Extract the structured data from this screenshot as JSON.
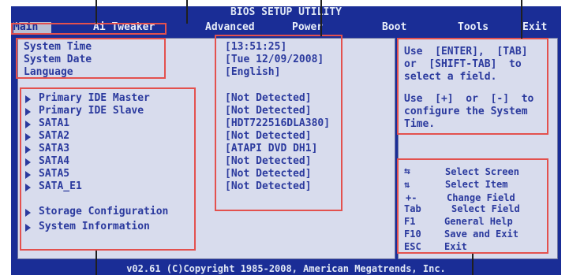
{
  "header": {
    "title": "BIOS SETUP UTILITY",
    "menu": [
      {
        "label": "Main",
        "active": true
      },
      {
        "label": "Ai Tweaker",
        "active": false
      },
      {
        "label": "Advanced",
        "active": false
      },
      {
        "label": "Power",
        "active": false
      },
      {
        "label": "Boot",
        "active": false
      },
      {
        "label": "Tools",
        "active": false
      },
      {
        "label": "Exit",
        "active": false
      }
    ]
  },
  "system": {
    "time_label": "System Time",
    "date_label": "System Date",
    "language_label": "Language",
    "time_value": "[13:51:25]",
    "date_value": "[Tue 12/09/2008]",
    "language_value": "[English]"
  },
  "devices": [
    {
      "label": "Primary IDE Master",
      "value": "[Not Detected]"
    },
    {
      "label": "Primary IDE Slave",
      "value": "[Not Detected]"
    },
    {
      "label": "SATA1",
      "value": "[HDT722516DLA380]"
    },
    {
      "label": "SATA2",
      "value": "[Not Detected]"
    },
    {
      "label": "SATA3",
      "value": "[ATAPI DVD DH1]"
    },
    {
      "label": "SATA4",
      "value": "[Not Detected]"
    },
    {
      "label": "SATA5",
      "value": "[Not Detected]"
    },
    {
      "label": "SATA_E1",
      "value": "[Not Detected]"
    }
  ],
  "submenus": {
    "storage": "Storage Configuration",
    "sysinfo": "System Information"
  },
  "help": {
    "line1": "Use  [ENTER],  [TAB]",
    "line2": "or  [SHIFT-TAB]  to",
    "line3": "select a field.",
    "line4": "Use  [+]  or  [-]  to",
    "line5": "configure the System",
    "line6": "Time."
  },
  "keys": {
    "select_screen": "Select Screen",
    "select_item": "Select Item",
    "plus_minus": "+-",
    "change_field": "Change Field",
    "tab": "Tab",
    "select_field": "Select Field",
    "f1": "F1",
    "general_help": "General Help",
    "f10": "F10",
    "save_exit": "Save and Exit",
    "esc": "ESC",
    "exit": "Exit"
  },
  "footer": "v02.61 (C)Copyright 1985-2008, American Megatrends, Inc.",
  "colors": {
    "blue": "#1a2d96",
    "panel": "#d8dced",
    "text": "#2b3a9e",
    "annotation": "#e3514e"
  }
}
